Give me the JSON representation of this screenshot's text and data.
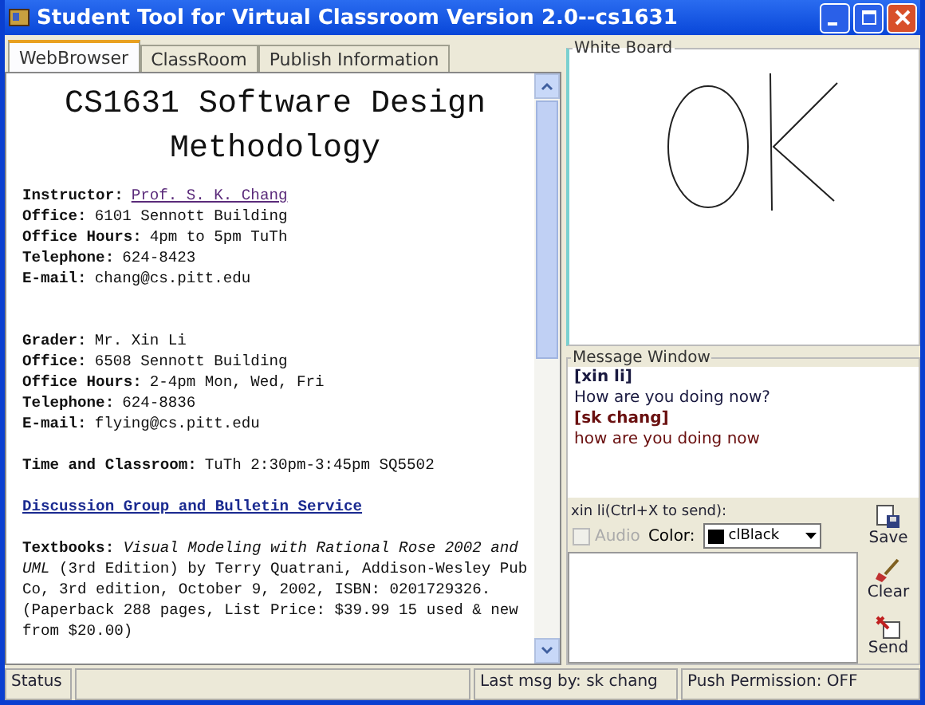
{
  "window": {
    "title": "Student Tool for Virtual Classroom Version 2.0--cs1631"
  },
  "tabs": [
    {
      "label": "WebBrowser",
      "selected": true
    },
    {
      "label": "ClassRoom",
      "selected": false
    },
    {
      "label": "Publish Information",
      "selected": false
    }
  ],
  "browser": {
    "heading": "CS1631 Software Design Methodology",
    "blocks": [
      {
        "kind": "fields",
        "lines": [
          {
            "label": "Instructor:",
            "value": "Prof. S. K. Chang",
            "link": true
          },
          {
            "label": "Office:",
            "value": "6101 Sennott Building",
            "link": false
          },
          {
            "label": "Office Hours:",
            "value": "4pm to 5pm TuTh",
            "link": false
          },
          {
            "label": "Telephone:",
            "value": "624-8423",
            "link": false
          },
          {
            "label": "E-mail:",
            "value": "chang@cs.pitt.edu",
            "link": false
          }
        ]
      },
      {
        "kind": "gap"
      },
      {
        "kind": "fields",
        "lines": [
          {
            "label": "Grader:",
            "value": "Mr. Xin Li",
            "link": false
          },
          {
            "label": "Office:",
            "value": "6508 Sennott Building",
            "link": false
          },
          {
            "label": "Office Hours:",
            "value": "2-4pm Mon, Wed, Fri",
            "link": false
          },
          {
            "label": "Telephone:",
            "value": "624-8836",
            "link": false
          },
          {
            "label": "E-mail:",
            "value": "flying@cs.pitt.edu",
            "link": false
          }
        ]
      },
      {
        "kind": "fields",
        "lines": [
          {
            "label": "Time and Classroom:",
            "value": "TuTh 2:30pm-3:45pm SQ5502",
            "link": false
          }
        ]
      },
      {
        "kind": "link",
        "text": "Discussion Group and Bulletin Service"
      },
      {
        "kind": "paragraph",
        "text": "**Textbooks:** *Visual Modeling with Rational Rose 2002 and UML* (3rd Edition) by Terry Quatrani, Addison-Wesley Pub Co, 3rd edition, October 9, 2002, ISBN: 0201729326. (Paperback 288 pages, List Price: $39.99 15 used & new from $20.00)"
      }
    ]
  },
  "whiteboard": {
    "title": "White Board"
  },
  "message_window": {
    "title": "Message Window",
    "messages": [
      {
        "sender": "[xin li]",
        "text": "How are you doing now?",
        "color": "#1a1a40"
      },
      {
        "sender": "[sk chang]",
        "text": "how are you doing now",
        "color": "#6a1010"
      }
    ],
    "input_label": "xin li(Ctrl+X to send):",
    "audio": {
      "label": "Audio",
      "checked": false,
      "disabled": true
    },
    "color_label": "Color:",
    "color_value": "clBlack",
    "buttons": [
      {
        "label": "Save",
        "kind": "save"
      },
      {
        "label": "Clear",
        "kind": "clear"
      },
      {
        "label": "Send",
        "kind": "send"
      }
    ]
  },
  "status_bar": [
    "Status",
    "Last msg by: sk chang",
    "Push Permission: OFF"
  ]
}
